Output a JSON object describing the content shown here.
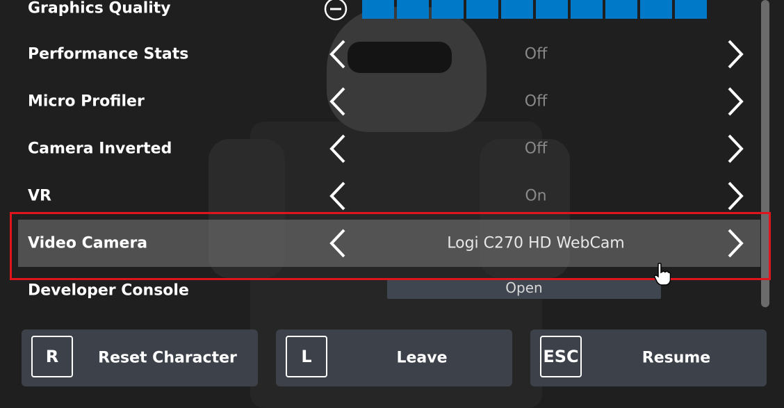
{
  "settings": {
    "graphics_quality": {
      "label": "Graphics Quality",
      "level": 10,
      "max": 10
    },
    "rows": [
      {
        "label": "Performance Stats",
        "value": "Off"
      },
      {
        "label": "Micro Profiler",
        "value": "Off"
      },
      {
        "label": "Camera Inverted",
        "value": "Off"
      },
      {
        "label": "VR",
        "value": "On"
      },
      {
        "label": "Video Camera",
        "value": "Logi C270 HD WebCam"
      }
    ],
    "developer_console": {
      "label": "Developer Console",
      "button": "Open"
    }
  },
  "actions": [
    {
      "key": "R",
      "label": "Reset Character"
    },
    {
      "key": "L",
      "label": "Leave"
    },
    {
      "key": "ESC",
      "label": "Resume"
    }
  ],
  "colors": {
    "quality_fill": "#0079c9",
    "highlight_border": "#e0141c",
    "selected_row": "#787878"
  },
  "icons": {
    "quality_decrease": "minus-circle-icon",
    "previous": "chevron-left-icon",
    "next": "chevron-right-icon",
    "pointer": "hand-cursor-icon"
  }
}
